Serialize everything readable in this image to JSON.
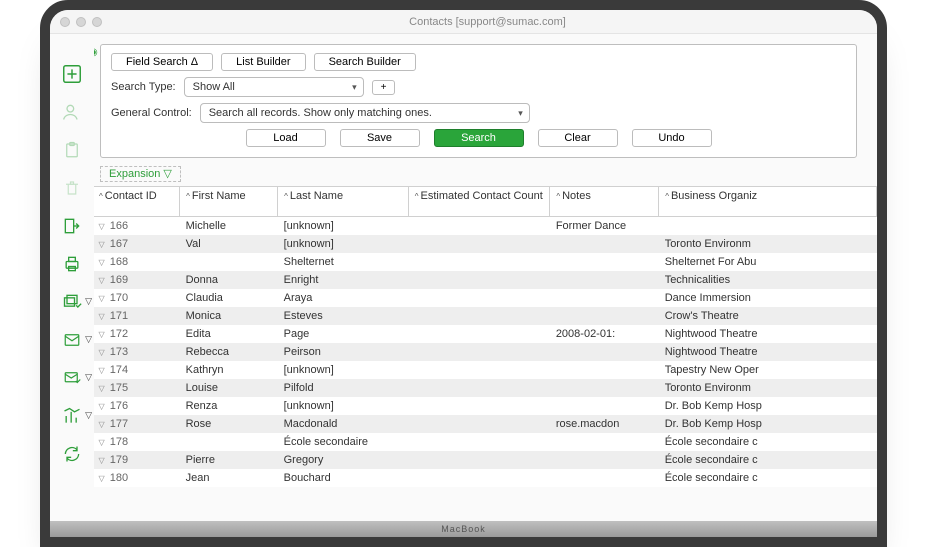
{
  "window": {
    "title": "Contacts   [support@sumac.com]"
  },
  "search": {
    "tab_field_search": "Field Search Δ",
    "tab_list_builder": "List Builder",
    "tab_search_builder": "Search Builder",
    "type_label": "Search Type:",
    "type_value": "Show All",
    "add_btn": "+",
    "general_label": "General Control:",
    "general_value": "Search all records. Show only matching ones.",
    "btn_load": "Load",
    "btn_save": "Save",
    "btn_search": "Search",
    "btn_clear": "Clear",
    "btn_undo": "Undo",
    "expansion_label": "Expansion ▽"
  },
  "table": {
    "columns": [
      "Contact ID",
      "First Name",
      "Last Name",
      "Estimated Contact Count",
      "Notes",
      "Business Organiz"
    ],
    "rows": [
      {
        "id": "166",
        "first": "Michelle",
        "last": "[unknown]",
        "est": "",
        "notes": "Former Dance",
        "org": ""
      },
      {
        "id": "167",
        "first": "Val",
        "last": "[unknown]",
        "est": "",
        "notes": "",
        "org": "Toronto Environm"
      },
      {
        "id": "168",
        "first": "",
        "last": "Shelternet",
        "est": "",
        "notes": "",
        "org": "Shelternet For Abu"
      },
      {
        "id": "169",
        "first": "Donna",
        "last": "Enright",
        "est": "",
        "notes": "",
        "org": "Technicalities"
      },
      {
        "id": "170",
        "first": "Claudia",
        "last": "Araya",
        "est": "",
        "notes": "",
        "org": "Dance Immersion"
      },
      {
        "id": "171",
        "first": "Monica",
        "last": "Esteves",
        "est": "",
        "notes": "",
        "org": "Crow's Theatre"
      },
      {
        "id": "172",
        "first": "Edita",
        "last": "Page",
        "est": "",
        "notes": "2008-02-01:",
        "org": "Nightwood Theatre"
      },
      {
        "id": "173",
        "first": "Rebecca",
        "last": "Peirson",
        "est": "",
        "notes": "",
        "org": "Nightwood Theatre"
      },
      {
        "id": "174",
        "first": "Kathryn",
        "last": "[unknown]",
        "est": "",
        "notes": "",
        "org": "Tapestry New Oper"
      },
      {
        "id": "175",
        "first": "Louise",
        "last": "Pilfold",
        "est": "",
        "notes": "",
        "org": "Toronto Environm"
      },
      {
        "id": "176",
        "first": "Renza",
        "last": "[unknown]",
        "est": "",
        "notes": "",
        "org": "Dr. Bob Kemp Hosp"
      },
      {
        "id": "177",
        "first": "Rose",
        "last": "Macdonald",
        "est": "",
        "notes": "rose.macdon",
        "org": "Dr. Bob Kemp Hosp"
      },
      {
        "id": "178",
        "first": "",
        "last": "École secondaire",
        "est": "",
        "notes": "",
        "org": "École secondaire c"
      },
      {
        "id": "179",
        "first": "Pierre",
        "last": "Gregory",
        "est": "",
        "notes": "",
        "org": "École secondaire c"
      },
      {
        "id": "180",
        "first": "Jean",
        "last": "Bouchard",
        "est": "",
        "notes": "",
        "org": "École secondaire c"
      }
    ]
  },
  "col_widths": [
    "80px",
    "90px",
    "120px",
    "130px",
    "100px",
    "200px"
  ],
  "hinge_label": "MacBook"
}
